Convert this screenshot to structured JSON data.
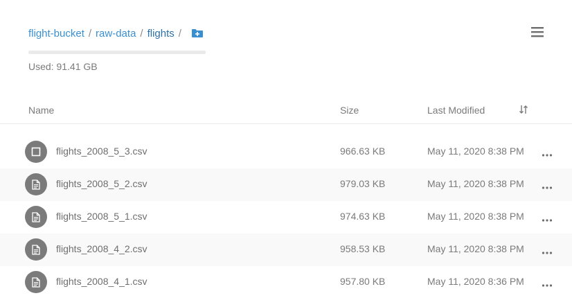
{
  "breadcrumb": {
    "items": [
      {
        "label": "flight-bucket"
      },
      {
        "label": "raw-data"
      },
      {
        "label": "flights"
      }
    ],
    "separator": "/"
  },
  "usage": {
    "label": "Used: 91.41 GB"
  },
  "table": {
    "columns": {
      "name": "Name",
      "size": "Size",
      "modified": "Last Modified"
    },
    "rows": [
      {
        "name": "flights_2008_5_3.csv",
        "size": "966.63 KB",
        "modified": "May 11, 2020 8:38 PM",
        "icon": "checkbox-icon"
      },
      {
        "name": "flights_2008_5_2.csv",
        "size": "979.03 KB",
        "modified": "May 11, 2020 8:38 PM",
        "icon": "document-icon"
      },
      {
        "name": "flights_2008_5_1.csv",
        "size": "974.63 KB",
        "modified": "May 11, 2020 8:38 PM",
        "icon": "document-icon"
      },
      {
        "name": "flights_2008_4_2.csv",
        "size": "958.53 KB",
        "modified": "May 11, 2020 8:38 PM",
        "icon": "document-icon"
      },
      {
        "name": "flights_2008_4_1.csv",
        "size": "957.80 KB",
        "modified": "May 11, 2020 8:36 PM",
        "icon": "document-icon"
      }
    ]
  },
  "icons": {
    "header": [
      "folder-add-icon",
      "hamburger-menu-icon",
      "sort-icon"
    ],
    "row_actions": "more-options-icon"
  },
  "colors": {
    "accent": "#3a8fd1",
    "icon_circle": "#7b7b7b",
    "text_muted": "#7a7a7a"
  }
}
